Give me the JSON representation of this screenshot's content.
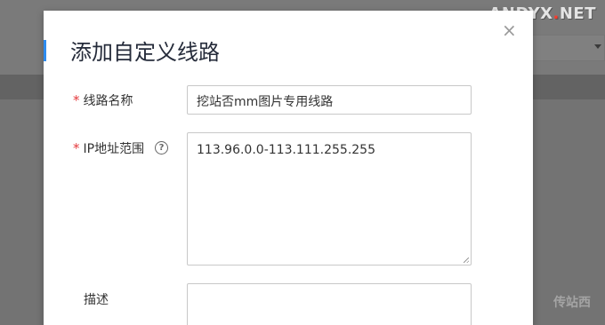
{
  "watermark": {
    "main": "ANDYX",
    "dot": ".",
    "suffix": "NET",
    "bottom": "传站西"
  },
  "modal": {
    "title": "添加自定义线路",
    "close_glyph": "×"
  },
  "form": {
    "required_mark": "*",
    "name": {
      "label": "线路名称",
      "value": "挖站否mm图片专用线路"
    },
    "ip_range": {
      "label": "IP地址范围",
      "help_glyph": "?",
      "value": "113.96.0.0-113.111.255.255"
    },
    "description": {
      "label": "描述",
      "value": ""
    }
  }
}
